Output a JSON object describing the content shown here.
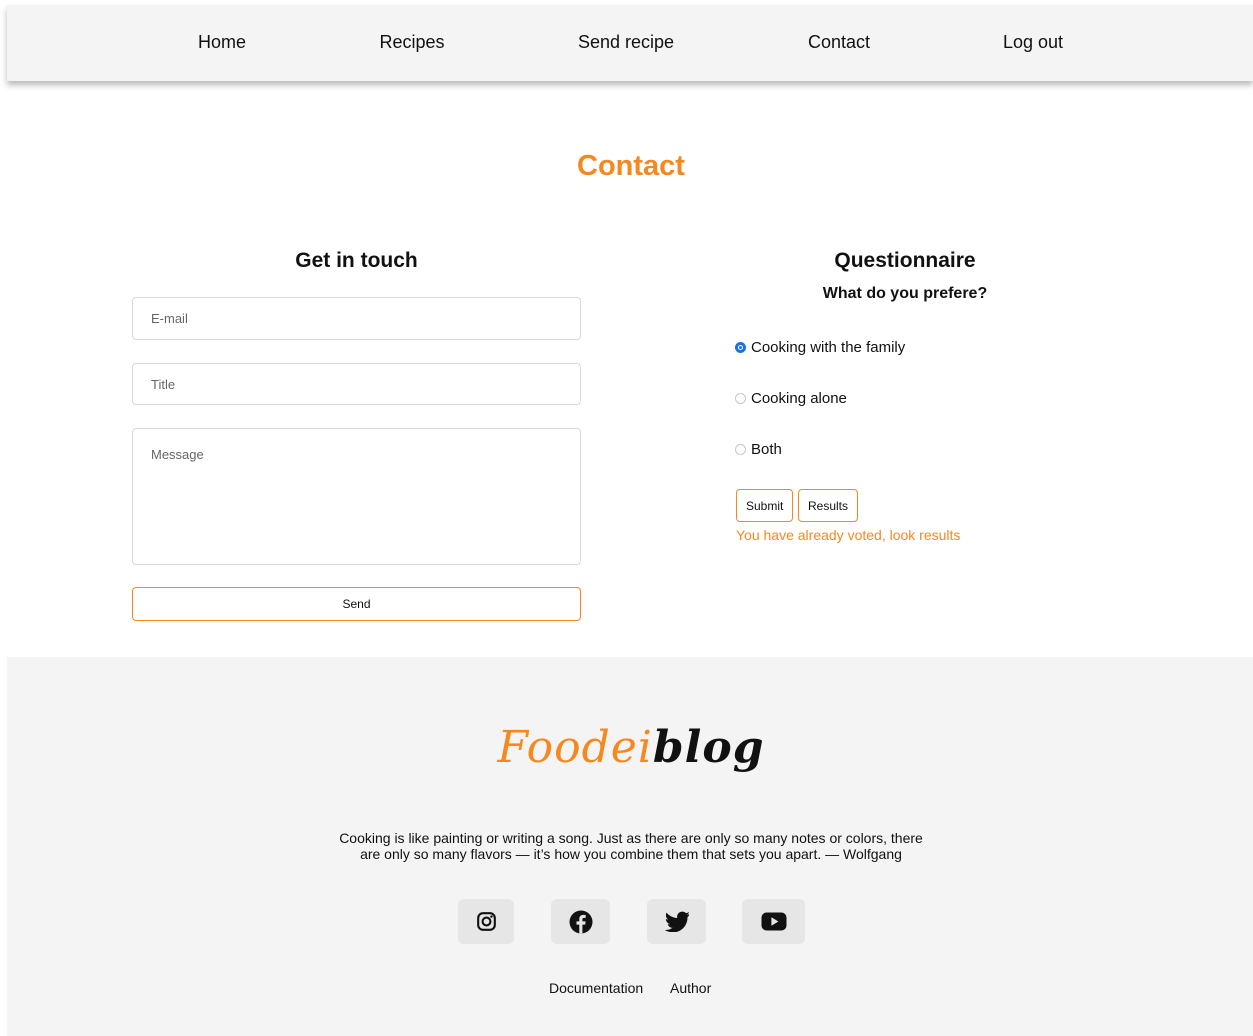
{
  "nav": {
    "items": [
      {
        "label": "Home"
      },
      {
        "label": "Recipes"
      },
      {
        "label": "Send recipe"
      },
      {
        "label": "Contact"
      },
      {
        "label": "Log out"
      }
    ]
  },
  "page": {
    "title": "Contact"
  },
  "contact_form": {
    "heading": "Get in touch",
    "email_placeholder": "E-mail",
    "title_placeholder": "Title",
    "message_placeholder": "Message",
    "send_label": "Send"
  },
  "questionnaire": {
    "heading": "Questionnaire",
    "question": "What do you prefere?",
    "options": [
      {
        "label": "Cooking with the family",
        "checked": true
      },
      {
        "label": "Cooking alone",
        "checked": false
      },
      {
        "label": "Both",
        "checked": false
      }
    ],
    "submit_label": "Submit",
    "results_label": "Results",
    "status_message": "You have already voted, look results"
  },
  "footer": {
    "logo_part1": "Foodei",
    "logo_part2": "blog",
    "quote_line1": "Cooking is like painting or writing a song. Just as there are only so many notes or colors, there",
    "quote_line2": "are only so many flavors — it’s how you combine them that sets you apart. — Wolfgang",
    "social": [
      {
        "icon": "instagram-icon"
      },
      {
        "icon": "facebook-icon"
      },
      {
        "icon": "twitter-icon"
      },
      {
        "icon": "youtube-icon"
      }
    ],
    "links": [
      {
        "label": "Documentation"
      },
      {
        "label": "Author"
      }
    ]
  },
  "colors": {
    "accent": "#f5881f",
    "nav_background": "#f4f4f4",
    "footer_background": "#f4f4f4",
    "radio_checked": "#1a73e8"
  }
}
